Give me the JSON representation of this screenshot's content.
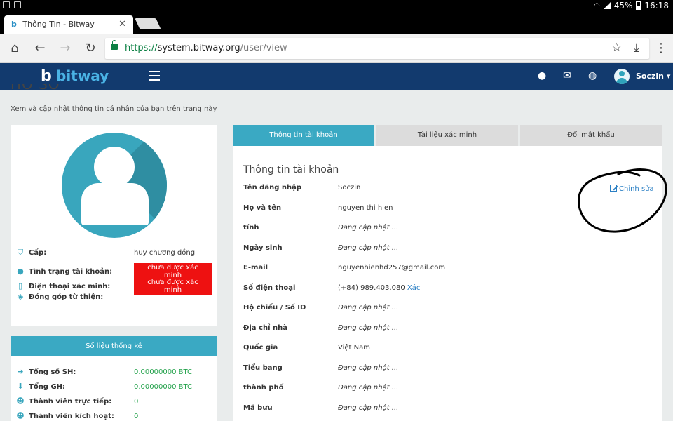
{
  "statusbar": {
    "battery": "45%",
    "time": "16:18"
  },
  "browser": {
    "tab_title": "Thông Tin - Bitway",
    "url_scheme": "https://",
    "url_host": "system.bitway.org",
    "url_path": "/user/view"
  },
  "header": {
    "logo": "bitway",
    "username": "Soczin"
  },
  "page": {
    "title": "HỒ SƠ",
    "subtitle": "Xem và cập nhật thông tin cá nhân của bạn trên trang này"
  },
  "profile": {
    "rows": [
      {
        "label": "Cấp:",
        "value": "huy chương đồng"
      },
      {
        "label": "Tình trạng tài khoản:",
        "value": "chưa được xác minh"
      },
      {
        "label": "Điện thoại xác minh:",
        "value": "chưa được xác minh"
      },
      {
        "label": "Đóng góp từ thiện:",
        "value": ""
      }
    ]
  },
  "stats": {
    "title": "Số liệu thống kê",
    "rows": [
      {
        "label": "Tổng số SH:",
        "value": "0.00000000 BTC"
      },
      {
        "label": "Tổng GH:",
        "value": "0.00000000 BTC"
      },
      {
        "label": "Thành viên trực tiếp:",
        "value": "0"
      },
      {
        "label": "Thành viên kích hoạt:",
        "value": "0"
      }
    ]
  },
  "tabs": [
    "Thông tin tài khoản",
    "Tài liệu xác minh",
    "Đổi mật khẩu"
  ],
  "account": {
    "title": "Thông tin tài khoản",
    "edit_label": "Chỉnh sửa",
    "rows": [
      {
        "label": "Tên đăng nhập",
        "value": "Soczin"
      },
      {
        "label": "Họ và tên",
        "value": "nguyen thi hien"
      },
      {
        "label": "tính",
        "value": "Đang cập nhật ..."
      },
      {
        "label": "Ngày sinh",
        "value": "Đang cập nhật ..."
      },
      {
        "label": "E-mail",
        "value": "nguyenhienhd257@gmail.com"
      },
      {
        "label": "Số điện thoại",
        "value": "(+84) 989.403.080",
        "link": "Xác"
      },
      {
        "label": "Hộ chiếu / Số ID",
        "value": "Đang cập nhật ..."
      },
      {
        "label": "Địa chỉ nhà",
        "value": "Đang cập nhật ..."
      },
      {
        "label": "Quốc gia",
        "value": "Việt Nam"
      },
      {
        "label": "Tiểu bang",
        "value": "Đang cập nhật ..."
      },
      {
        "label": "thành phố",
        "value": "Đang cập nhật ..."
      },
      {
        "label": "Mã bưu",
        "value": "Đang cập nhật ..."
      }
    ]
  }
}
